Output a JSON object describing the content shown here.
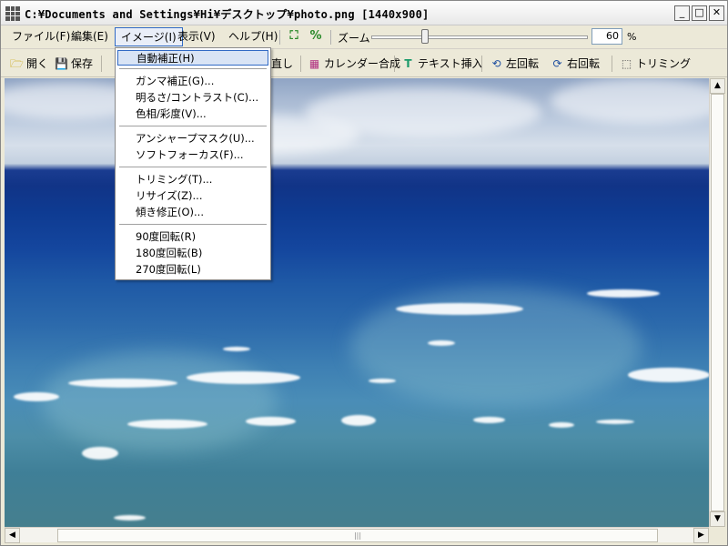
{
  "window": {
    "title": "C:¥Documents and Settings¥Hi¥デスクトップ¥photo.png  [1440x900]",
    "minimize": "_",
    "maximize": "□",
    "close": "✕"
  },
  "menubar": {
    "items": [
      {
        "label": "ファイル(F)"
      },
      {
        "label": "編集(E)"
      },
      {
        "label": "イメージ(I)"
      },
      {
        "label": "表示(V)"
      },
      {
        "label": "ヘルプ(H)"
      }
    ],
    "zoom_label": "ズーム",
    "zoom_value": "60",
    "zoom_unit": "%",
    "zoom_slider_fraction": 0.24
  },
  "toolbar": {
    "open": "開く",
    "save": "保存",
    "redo_partial": "直し",
    "calendar": "カレンダー合成",
    "text_insert": "テキスト挿入",
    "rotate_left": "左回転",
    "rotate_right": "右回転",
    "trim": "トリミング"
  },
  "image_menu": {
    "items": [
      {
        "label": "自動補正(H)",
        "highlighted": true
      },
      {
        "label": "ガンマ補正(G)..."
      },
      {
        "label": "明るさ/コントラスト(C)..."
      },
      {
        "label": "色相/彩度(V)..."
      },
      {
        "label": "アンシャープマスク(U)..."
      },
      {
        "label": "ソフトフォーカス(F)..."
      },
      {
        "label": "トリミング(T)..."
      },
      {
        "label": "リサイズ(Z)..."
      },
      {
        "label": "傾き修正(O)..."
      },
      {
        "label": "90度回転(R)"
      },
      {
        "label": "180度回転(B)"
      },
      {
        "label": "270度回転(L)"
      }
    ]
  },
  "scrollbars": {
    "up": "▲",
    "down": "▼",
    "left": "◀",
    "right": "▶",
    "grip": "|||"
  },
  "colors": {
    "menu_highlight_border": "#316ac5",
    "menu_highlight_bg": "#d9e4f5",
    "sea_deep": "#113487",
    "sea_shallow": "#4a8db7"
  }
}
